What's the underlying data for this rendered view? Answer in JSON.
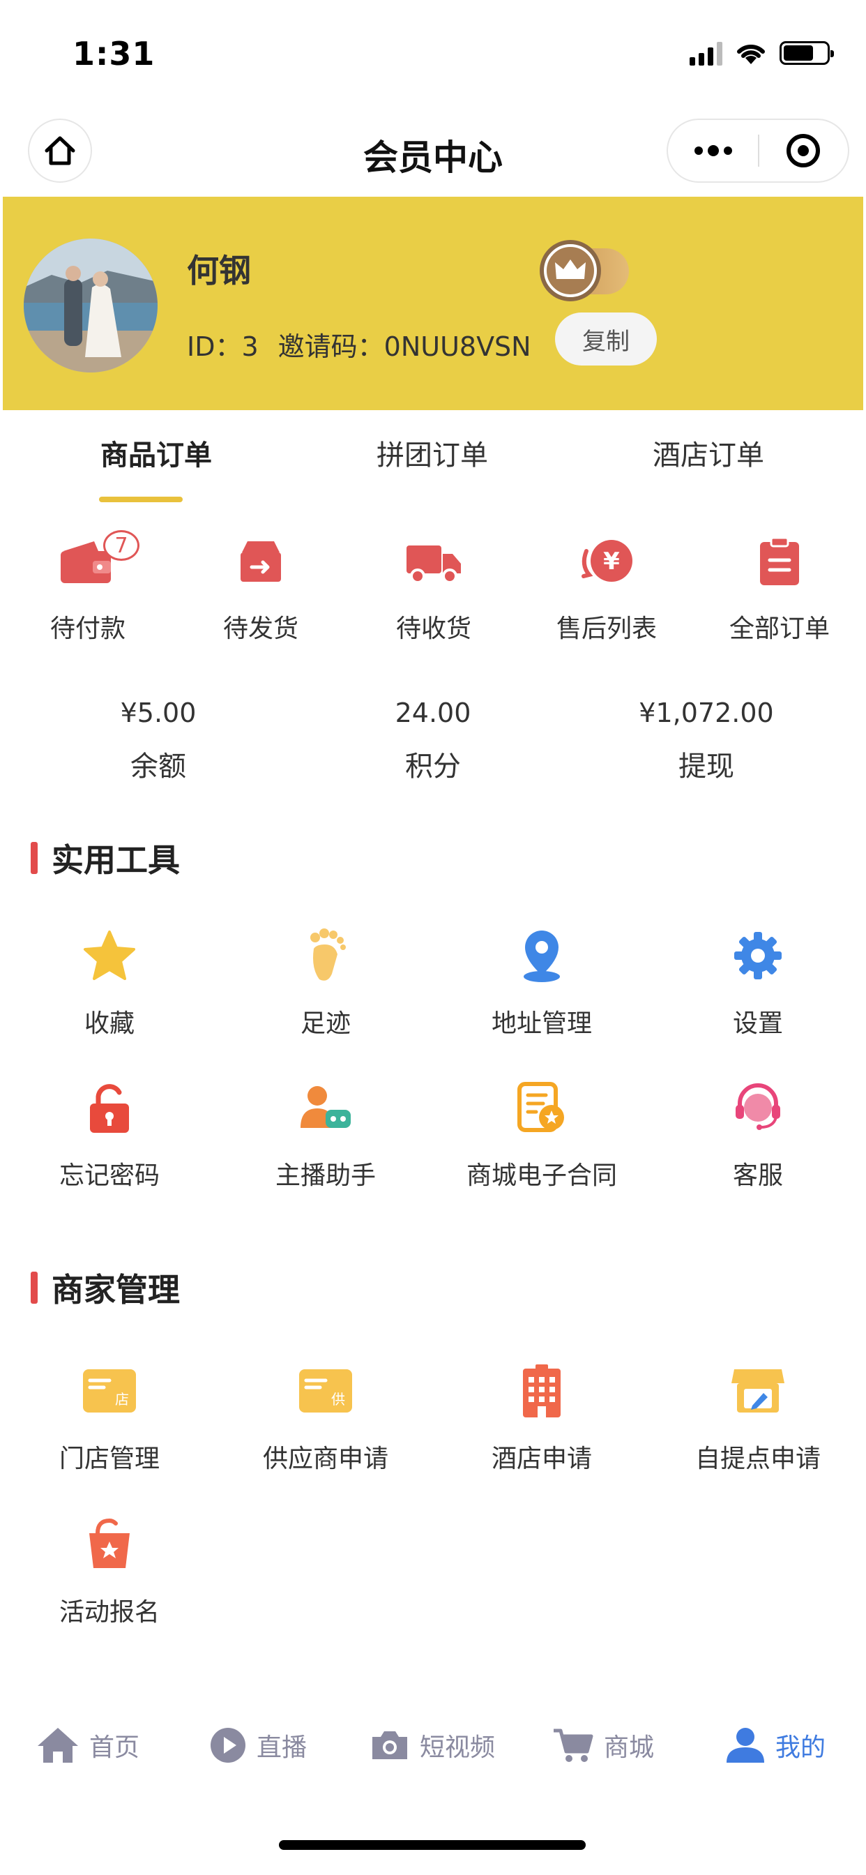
{
  "status_bar": {
    "time": "1:31"
  },
  "nav": {
    "title": "会员中心"
  },
  "profile": {
    "name": "何钢",
    "id_text": "ID：3",
    "invite_text": "邀请码：0NUU8VSN",
    "copy_label": "复制"
  },
  "order_tabs": [
    {
      "label": "商品订单",
      "active": true
    },
    {
      "label": "拼团订单",
      "active": false
    },
    {
      "label": "酒店订单",
      "active": false
    }
  ],
  "order_status": [
    {
      "label": "待付款",
      "icon": "wallet-icon",
      "badge": "7"
    },
    {
      "label": "待发货",
      "icon": "box-icon"
    },
    {
      "label": "待收货",
      "icon": "truck-icon"
    },
    {
      "label": "售后列表",
      "icon": "refund-icon"
    },
    {
      "label": "全部订单",
      "icon": "clipboard-icon"
    }
  ],
  "stats": [
    {
      "value": "¥5.00",
      "label": "余额"
    },
    {
      "value": "24.00",
      "label": "积分"
    },
    {
      "value": "¥1,072.00",
      "label": "提现"
    }
  ],
  "tools": {
    "title": "实用工具",
    "items": [
      {
        "label": "收藏",
        "icon": "star-icon"
      },
      {
        "label": "足迹",
        "icon": "footprint-icon"
      },
      {
        "label": "地址管理",
        "icon": "location-pin-icon"
      },
      {
        "label": "设置",
        "icon": "gear-icon"
      },
      {
        "label": "忘记密码",
        "icon": "unlock-icon"
      },
      {
        "label": "主播助手",
        "icon": "streamer-assistant-icon"
      },
      {
        "label": "商城电子合同",
        "icon": "contract-icon"
      },
      {
        "label": "客服",
        "icon": "headset-icon"
      }
    ]
  },
  "merchant": {
    "title": "商家管理",
    "items": [
      {
        "label": "门店管理",
        "icon": "store-card-icon"
      },
      {
        "label": "供应商申请",
        "icon": "supplier-card-icon"
      },
      {
        "label": "酒店申请",
        "icon": "hotel-icon"
      },
      {
        "label": "自提点申请",
        "icon": "pickup-store-icon"
      },
      {
        "label": "活动报名",
        "icon": "activity-bag-icon"
      }
    ]
  },
  "tabbar": [
    {
      "label": "首页",
      "icon": "home-icon",
      "active": false
    },
    {
      "label": "直播",
      "icon": "play-icon",
      "active": false
    },
    {
      "label": "短视频",
      "icon": "camera-icon",
      "active": false
    },
    {
      "label": "商城",
      "icon": "cart-icon",
      "active": false
    },
    {
      "label": "我的",
      "icon": "user-icon",
      "active": true
    }
  ],
  "colors": {
    "header_bg": "#e9ce46",
    "accent_red": "#e05656",
    "tab_active": "#3f7be0",
    "underline": "#e9c13c"
  }
}
